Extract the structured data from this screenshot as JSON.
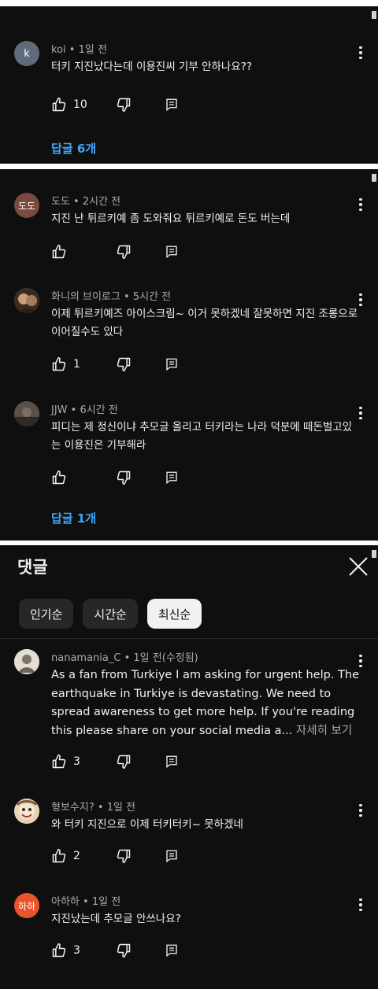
{
  "panels": [
    {
      "comments": [
        {
          "author": "koi",
          "time": "1일 전",
          "text": "터키 지진났다는데 이용진씨 기부 안하나요??",
          "likes": "10",
          "avatar_letter": "k",
          "avatar_color": "#5f6b7a"
        }
      ],
      "replies_link": "답글 6개"
    },
    {
      "comments": [
        {
          "author": "도도",
          "time": "2시간 전",
          "text": "지진 난 튀르키예 좀 도와줘요 튀르키예로 돈도 버는데",
          "likes": "",
          "avatar_letter": "도도",
          "avatar_color": "#7b4a3e"
        },
        {
          "author": "화니의 브이로그",
          "time": "5시간 전",
          "text": "이제 튀르키예즈 아이스크림~ 이거 못하겠네 잘못하면 지진 조롱으로 이어질수도 있다",
          "likes": "1",
          "avatar_color": "#6b4f3a"
        },
        {
          "author": "JJW",
          "time": "6시간 전",
          "text": "피디는 제 정신이냐 추모글 올리고 터키라는 나라 덕분에 떼돈벌고있는 이용진은 기부해라",
          "likes": "",
          "avatar_color": "#4a4540"
        }
      ],
      "replies_link": "답글 1개"
    },
    {
      "header": "댓글",
      "chips": [
        "인기순",
        "시간순",
        "최신순"
      ],
      "active_chip": "최신순",
      "comments": [
        {
          "author": "nanamania_C",
          "time": "1일 전(수정됨)",
          "text": "As a fan from Turkiye I am asking for urgent help. The earthquake in Turkiye is devastating. We need to spread awareness to get more help. If you're reading this please share on your social media a...",
          "read_more": "자세히 보기",
          "likes": "3",
          "avatar_color": "#d8d4c8"
        },
        {
          "author": "형보수지?",
          "time": "1일 전",
          "text": "와 터키 지진으로 이제 터키터키~ 못하겠네",
          "likes": "2",
          "avatar_color": "#c9a27a"
        },
        {
          "author": "아하하",
          "time": "1일 전",
          "text": "지진났는데 추모글 안쓰나요?",
          "likes": "3",
          "avatar_letter": "하하",
          "avatar_color": "#e8552a"
        }
      ]
    }
  ],
  "meta_separator": " • ",
  "icons": {
    "like": "thumbs-up-icon",
    "dislike": "thumbs-down-icon",
    "reply": "reply-icon",
    "more": "more-vert-icon",
    "close": "close-icon"
  }
}
